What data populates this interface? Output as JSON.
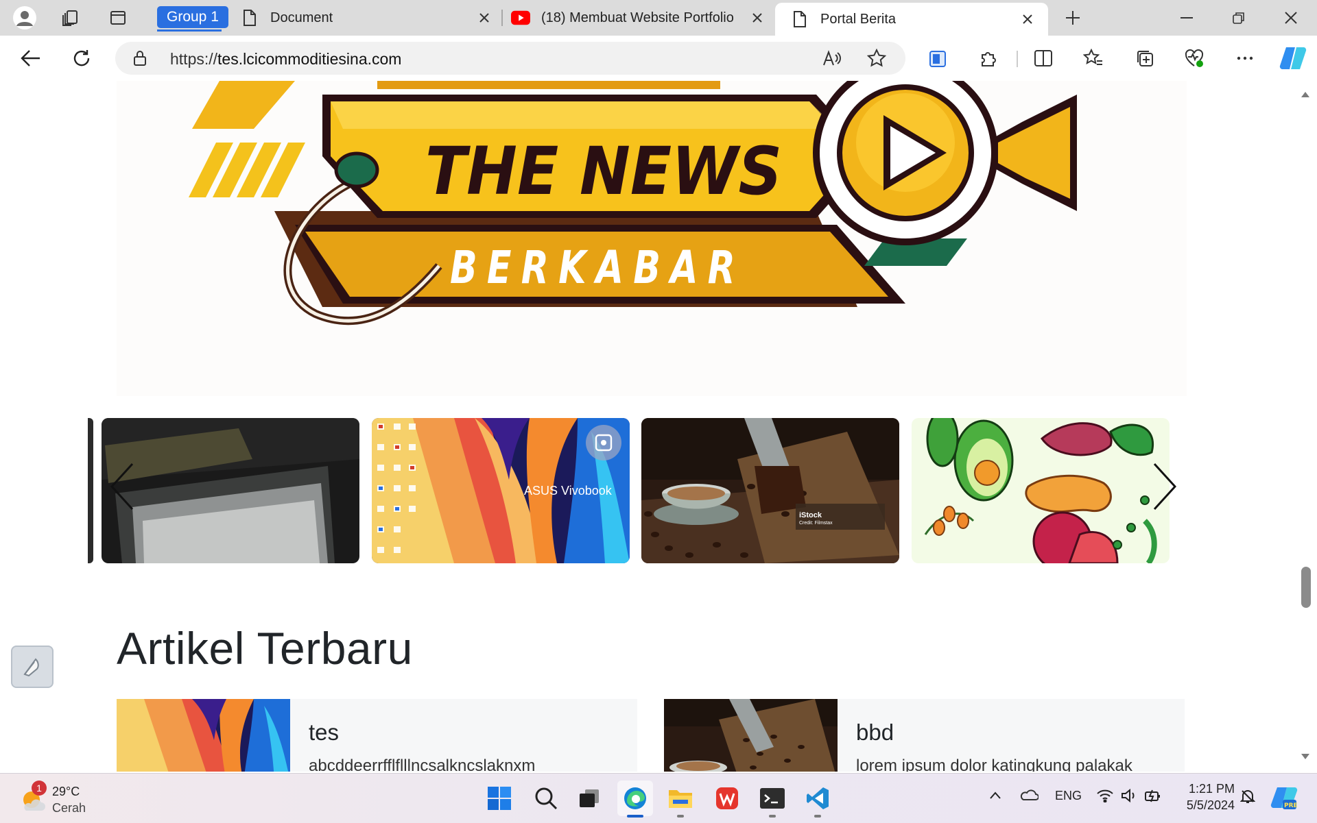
{
  "tabs": {
    "group_label": "Group 1",
    "items": [
      {
        "label": "Document"
      },
      {
        "label": "(18) Membuat Website Portfolio"
      },
      {
        "label": "Portal Berita"
      }
    ]
  },
  "address_bar": {
    "scheme": "https://",
    "host": "tes.lcicommoditiesina.com"
  },
  "banner": {
    "title": "THE NEWS",
    "subtitle": "BERKABAR"
  },
  "carousel": {
    "slides": [
      {
        "name": "dark-photo"
      },
      {
        "name": "asus-wallpaper",
        "caption": "ASUS Vivobook"
      },
      {
        "name": "coffee-photo",
        "watermark": "iStock",
        "credit": "Credit: Filmstax"
      },
      {
        "name": "fruit-illustration"
      }
    ]
  },
  "section": {
    "heading": "Artikel Terbaru"
  },
  "articles": [
    {
      "title": "tes",
      "excerpt": "abcddeerrfflflllncsalkncslaknxm"
    },
    {
      "title": "bbd",
      "excerpt": "lorem ipsum dolor katingkung palakak"
    }
  ],
  "taskbar": {
    "weather_temp": "29°C",
    "weather_cond": "Cerah",
    "weather_badge": "1",
    "language": "ENG",
    "time": "1:21 PM",
    "date": "5/5/2024"
  },
  "colors": {
    "accent": "#2a6fe0",
    "banner_gold": "#f2b51a",
    "banner_dark": "#2a0f12",
    "youtube_red": "#ff0000"
  }
}
